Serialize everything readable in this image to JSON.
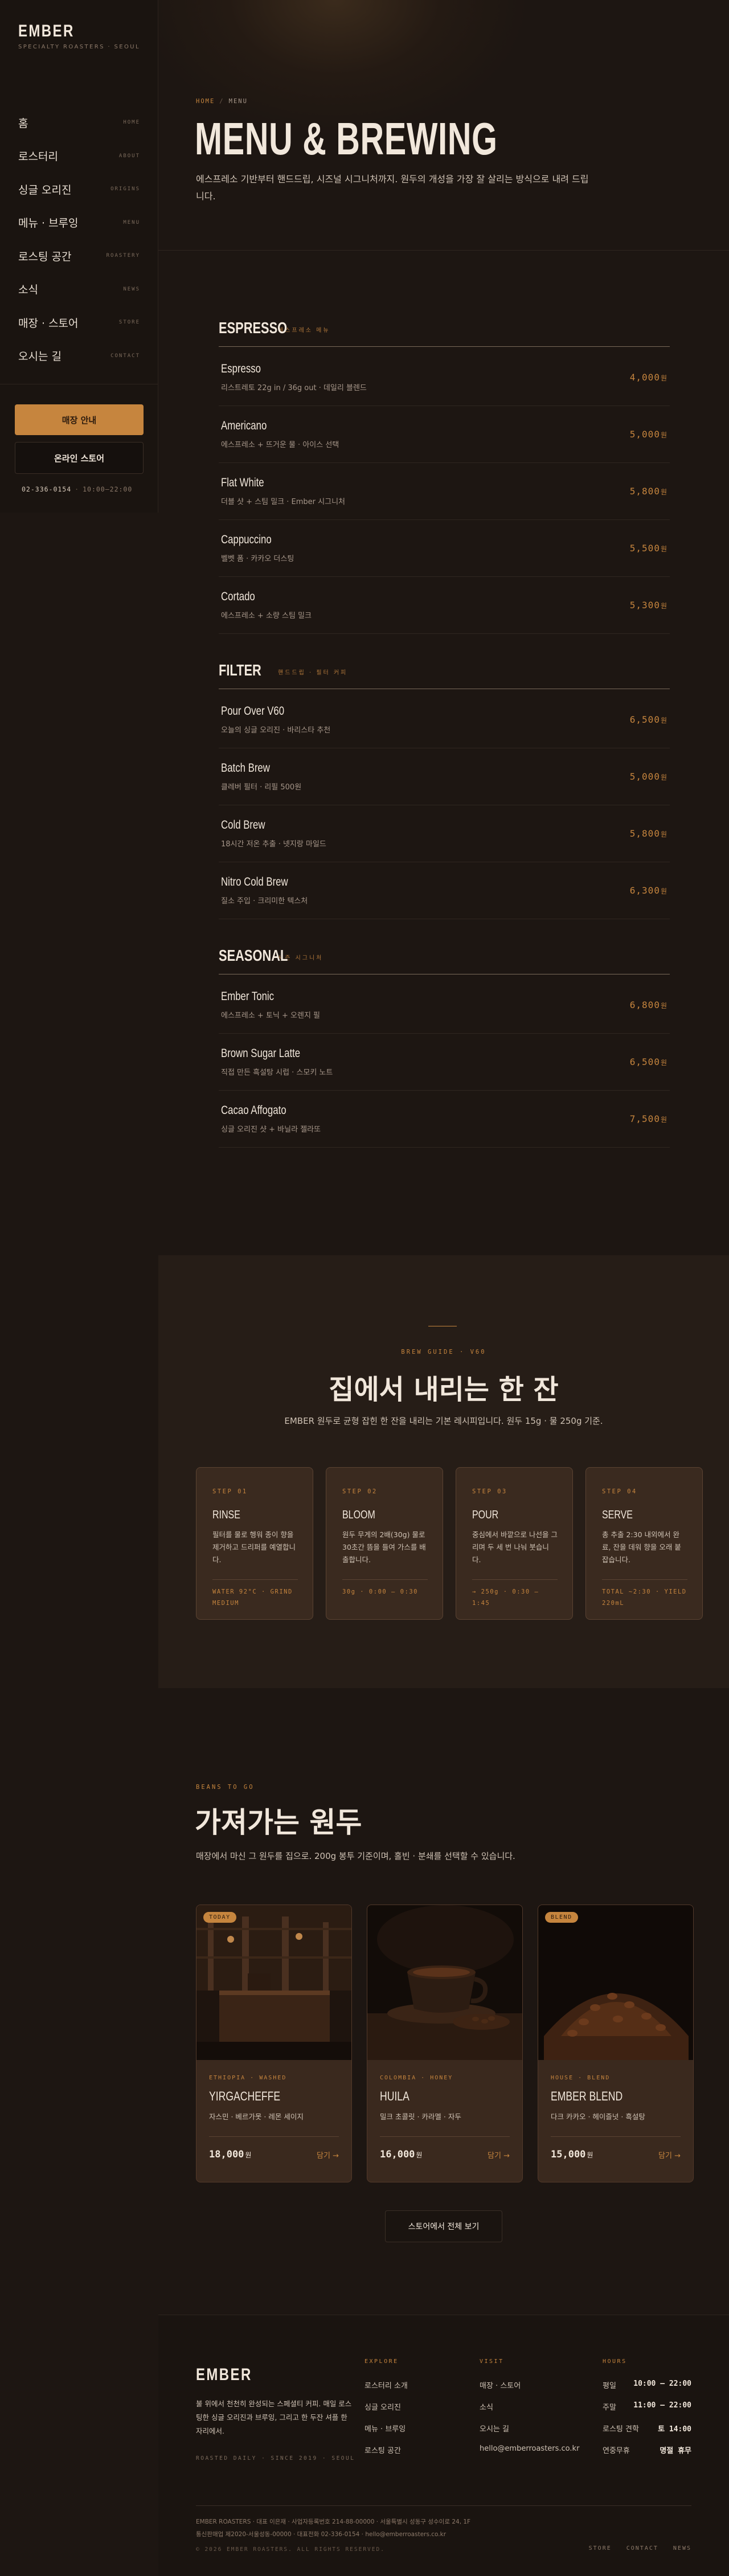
{
  "sidebar": {
    "brand": "EMBER",
    "tagline": "SPECIALTY ROASTERS · SEOUL",
    "nav": [
      {
        "label": "홈",
        "en": "HOME"
      },
      {
        "label": "로스터리",
        "en": "ABOUT"
      },
      {
        "label": "싱글 오리진",
        "en": "ORIGINS"
      },
      {
        "label": "메뉴 · 브루잉",
        "en": "MENU"
      },
      {
        "label": "로스팅 공간",
        "en": "ROASTERY"
      },
      {
        "label": "소식",
        "en": "NEWS"
      },
      {
        "label": "매장 · 스토어",
        "en": "STORE"
      },
      {
        "label": "오시는 길",
        "en": "CONTACT"
      }
    ],
    "primary_button": "매장 안내",
    "secondary_button": "온라인 스토어",
    "phone": "02-336-0154",
    "hours": "10:00–22:00"
  },
  "hero": {
    "breadcrumb_home": "HOME",
    "breadcrumb_current": "MENU",
    "title": "MENU & BREWING",
    "description": "에스프레소 기반부터 핸드드립, 시즈널 시그니처까지. 원두의 개성을 가장 잘 살리는 방식으로 내려 드립니다."
  },
  "menu": [
    {
      "title": "ESPRESSO",
      "en": "에스프레소 메뉴",
      "items": [
        {
          "name": "Espresso",
          "desc": "리스트레토 22g in / 36g out · 데일리 블렌드",
          "price": "4,000",
          "currency": "원"
        },
        {
          "name": "Americano",
          "desc": "에스프레소 + 뜨거운 물 · 아이스 선택",
          "price": "5,000",
          "currency": "원"
        },
        {
          "name": "Flat White",
          "desc": "더블 샷 + 스팀 밀크 · Ember 시그니처",
          "price": "5,800",
          "currency": "원"
        },
        {
          "name": "Cappuccino",
          "desc": "벨벳 폼 · 카카오 더스팅",
          "price": "5,500",
          "currency": "원"
        },
        {
          "name": "Cortado",
          "desc": "에스프레소 + 소량 스팀 밀크",
          "price": "5,300",
          "currency": "원"
        }
      ]
    },
    {
      "title": "FILTER",
      "en": "핸드드립 · 필터 커피",
      "items": [
        {
          "name": "Pour Over V60",
          "desc": "오늘의 싱글 오리진 · 바리스타 추천",
          "price": "6,500",
          "currency": "원"
        },
        {
          "name": "Batch Brew",
          "desc": "클레버 필터 · 리필 500원",
          "price": "5,000",
          "currency": "원"
        },
        {
          "name": "Cold Brew",
          "desc": "18시간 저온 추출 · 넷지랑 마일드",
          "price": "5,800",
          "currency": "원"
        },
        {
          "name": "Nitro Cold Brew",
          "desc": "질소 주입 · 크리미한 텍스처",
          "price": "6,300",
          "currency": "원"
        }
      ]
    },
    {
      "title": "SEASONAL",
      "en": "시즌 시그니처",
      "items": [
        {
          "name": "Ember Tonic",
          "desc": "에스프레소 + 토닉 + 오렌지 필",
          "price": "6,800",
          "currency": "원"
        },
        {
          "name": "Brown Sugar Latte",
          "desc": "직접 만든 흑설탕 시럽 · 스모키 노트",
          "price": "6,500",
          "currency": "원"
        },
        {
          "name": "Cacao Affogato",
          "desc": "싱글 오리진 샷 + 바닐라 젤라또",
          "price": "7,500",
          "currency": "원"
        }
      ]
    }
  ],
  "brew": {
    "label": "BREW GUIDE · V60",
    "title": "집에서 내리는 한 잔",
    "subtitle": "EMBER 원두로 균형 잡힌 한 잔을 내리는 기본 레시피입니다. 원두 15g · 물 250g 기준.",
    "steps": [
      {
        "num": "STEP 01",
        "name": "RINSE",
        "desc": "필터를 물로 헹워 종이 향을 제거하고 드리퍼를 예열합니다.",
        "meta": "WATER 92°C · GRIND MEDIUM"
      },
      {
        "num": "STEP 02",
        "name": "BLOOM",
        "desc": "원두 무게의 2배(30g) 물로 30초간 뜸을 들여 가스를 배출합니다.",
        "meta": "30g · 0:00 – 0:30"
      },
      {
        "num": "STEP 03",
        "name": "POUR",
        "desc": "중심에서 바깥으로 나선을 그리며 두 세 번 나눠 붓습니다.",
        "meta": "→ 250g · 0:30 – 1:45"
      },
      {
        "num": "STEP 04",
        "name": "SERVE",
        "desc": "총 추출 2:30 내외에서 완료, 잔을 데워 향을 오래 붙잡습니다.",
        "meta": "TOTAL ~2:30 · YIELD 220mL"
      }
    ]
  },
  "beans": {
    "label": "BEANS TO GO",
    "title": "가져가는 원두",
    "subtitle": "매장에서 마신 그 원두를 집으로. 200g 봉투 기준이며, 홀빈 · 분쇄를 선택할 수 있습니다.",
    "cards": [
      {
        "badge": "TODAY",
        "origin": "ETHIOPIA · WASHED",
        "name": "YIRGACHEFFE",
        "notes": "자스민 · 베르가못 · 레몬 세이지",
        "price": "18,000",
        "currency": "원",
        "add": "담기 →"
      },
      {
        "badge": "",
        "origin": "COLOMBIA · HONEY",
        "name": "HUILA",
        "notes": "밀크 초콜릿 · 카라멜 · 자두",
        "price": "16,000",
        "currency": "원",
        "add": "담기 →"
      },
      {
        "badge": "BLEND",
        "origin": "HOUSE · BLEND",
        "name": "EMBER BLEND",
        "notes": "다크 카카오 · 헤이즐넛 · 흑설탕",
        "price": "15,000",
        "currency": "원",
        "add": "담기 →"
      }
    ],
    "store_button": "스토어에서 전체 보기"
  },
  "footer": {
    "brand": "EMBER",
    "description": "불 위에서 천천히 완성되는 스페셜티 커피. 매일 로스팅한 싱글 오리진과 브루잉, 그리고 한 두잔 셔플 한 자리에서.",
    "tagline": "ROASTED DAILY · SINCE 2019 · SEOUL",
    "explore_title": "EXPLORE",
    "explore": [
      "로스터리 소개",
      "싱글 오리진",
      "메뉴 · 브루잉",
      "로스팅 공간"
    ],
    "visit_title": "VISIT",
    "visit": [
      "매장 · 스토어",
      "소식",
      "오시는 길",
      "hello@emberroasters.co.kr"
    ],
    "hours_title": "HOURS",
    "hours": [
      {
        "day": "평일",
        "time": "10:00 – 22:00"
      },
      {
        "day": "주말",
        "time": "11:00 – 22:00"
      },
      {
        "day": "로스팅 견학",
        "time": "토 14:00"
      },
      {
        "day": "연중무휴",
        "time": "명절 휴무"
      }
    ],
    "legal_1": "EMBER ROASTERS · 대표 이은재 · 사업자등록번호 214-88-00000 · 서울특별시 성동구 성수이로 24, 1F",
    "legal_2": "통신판매업 제2020-서울성동-00000 · 대표전화 02-336-0154 · hello@emberroasters.co.kr",
    "copyright": "© 2026 EMBER ROASTERS. ALL RIGHTS RESERVED.",
    "bottom_links": [
      "STORE",
      "CONTACT",
      "NEWS"
    ]
  }
}
